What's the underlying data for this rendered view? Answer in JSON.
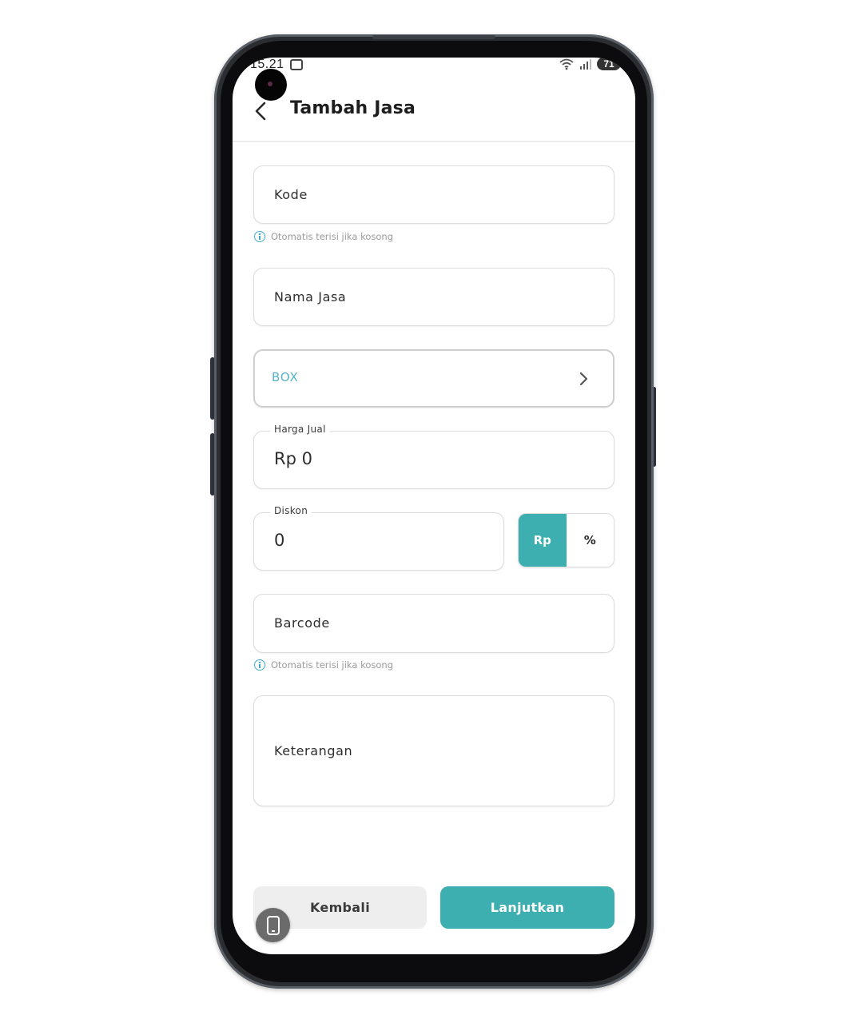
{
  "status_bar": {
    "time": "15.21",
    "battery": "71"
  },
  "header": {
    "title": "Tambah Jasa"
  },
  "form": {
    "kode": {
      "placeholder": "Kode",
      "hint": "Otomatis terisi jika kosong"
    },
    "nama_jasa": {
      "placeholder": "Nama Jasa"
    },
    "category": {
      "value": "BOX"
    },
    "harga_jual": {
      "label": "Harga Jual",
      "value": "Rp 0"
    },
    "diskon": {
      "label": "Diskon",
      "value": "0",
      "unit_options": [
        "Rp",
        "%"
      ],
      "selected_unit": "Rp"
    },
    "barcode": {
      "placeholder": "Barcode",
      "hint": "Otomatis terisi jika kosong"
    },
    "keterangan": {
      "placeholder": "Keterangan"
    }
  },
  "actions": {
    "back_label": "Kembali",
    "next_label": "Lanjutkan"
  },
  "colors": {
    "accent": "#3dafb1",
    "hint_icon": "#41a8c9",
    "category_text": "#56b3c8"
  },
  "icons": {
    "back": "chevron-left-icon",
    "category_arrow": "chevron-right-icon",
    "hint": "info-icon",
    "floating": "phone-icon"
  }
}
